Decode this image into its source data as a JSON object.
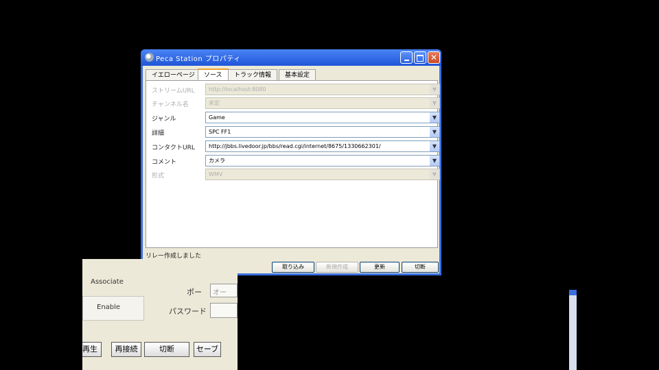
{
  "window": {
    "title": "Peca Station プロパティ",
    "controls": {
      "minimize": "",
      "maximize": "",
      "close": "✕"
    }
  },
  "tabs": [
    {
      "label": "イエローページ"
    },
    {
      "label": "ソース"
    },
    {
      "label": "トラック情報"
    },
    {
      "label": "基本設定"
    }
  ],
  "fields": {
    "stream_url": {
      "label": "ストリームURL",
      "value": "http://localhost:8080"
    },
    "channel_name": {
      "label": "チャンネル名",
      "value": "未定"
    },
    "genre": {
      "label": "ジャンル",
      "value": "Game"
    },
    "description": {
      "label": "詳細",
      "value": "SPC FF1"
    },
    "contact_url": {
      "label": "コンタクトURL",
      "value": "http://jbbs.livedoor.jp/bbs/read.cgi/internet/8675/1330662301/"
    },
    "comment": {
      "label": "コメント",
      "value": "カメラ"
    },
    "format": {
      "label": "形式",
      "value": "WMV"
    }
  },
  "status": {
    "text": "リレー作成しました"
  },
  "buttons": {
    "load": "取り込み",
    "new_create": "新規作成",
    "update": "更新",
    "disconnect": "切断"
  },
  "overlay": {
    "text1": "Associate",
    "label_port": "ポー",
    "port_value": "オー",
    "text2": "Enable",
    "label_password": "パスワード",
    "btn_play": "再生",
    "btn_reconnect": "再接続",
    "btn_disconnect": "切断",
    "btn_save": "セーブ"
  }
}
